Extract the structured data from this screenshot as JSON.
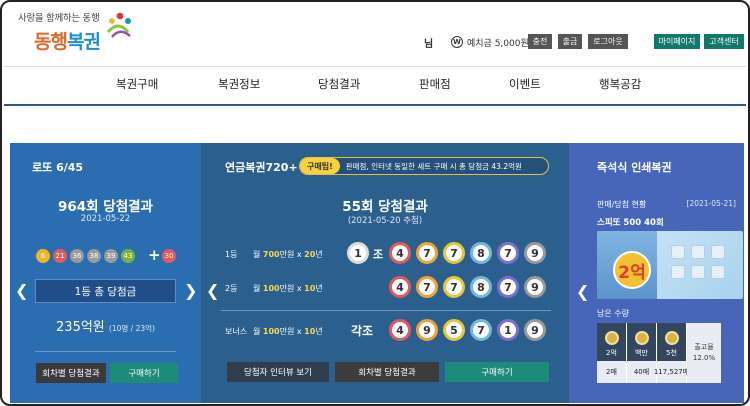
{
  "header": {
    "slogan": "사랑을 함께하는 동행",
    "brand_part1": "동행",
    "brand_part2": "복권",
    "user_suffix": "님",
    "won_symbol": "W",
    "deposit": "예치금 5,000원",
    "buttons": [
      "충전",
      "출금",
      "로그아웃",
      "마이페이지",
      "고객센터"
    ]
  },
  "nav": [
    "복권구매",
    "복권정보",
    "당첨결과",
    "판매점",
    "이벤트",
    "행복공감"
  ],
  "lotto": {
    "title": "로또 6/45",
    "round": "964회 당첨결과",
    "date": "2021-05-22",
    "numbers": [
      "6",
      "21",
      "36",
      "38",
      "39",
      "43"
    ],
    "bonus": "30",
    "plus": "+",
    "first_prize_label": "1등 총 당첨금",
    "amount": "235억원",
    "amount_detail": "(10명 / 23억)",
    "btn_results": "회차별 당첨결과",
    "btn_buy": "구매하기",
    "ball_colors": [
      "#f0b62a",
      "#e45b5b",
      "#9a9a9a",
      "#9a9a9a",
      "#9a9a9a",
      "#7bb23e",
      "#e45b5b"
    ]
  },
  "pension": {
    "title": "연금복권720+",
    "tip_label": "구매팁!",
    "tip_text": "판매점, 인터넷 동일한 세트 구매 시 총 당첨금 43.2억원",
    "round": "55회 당첨결과",
    "date": "(2021-05-20 추첨)",
    "rows": [
      {
        "rank": "1등",
        "desc_prefix": "월 ",
        "desc_amount": "700",
        "desc_mid": "만원 x ",
        "desc_years": "20",
        "desc_suffix": "년",
        "jo": "1",
        "jo_label": "조",
        "digits": [
          "4",
          "7",
          "7",
          "8",
          "7",
          "9"
        ]
      },
      {
        "rank": "2등",
        "desc_prefix": "월 ",
        "desc_amount": "100",
        "desc_mid": "만원 x ",
        "desc_years": "10",
        "desc_suffix": "년",
        "digits": [
          "4",
          "7",
          "7",
          "8",
          "7",
          "9"
        ]
      },
      {
        "rank": "보너스",
        "desc_prefix": "월 ",
        "desc_amount": "100",
        "desc_mid": "만원 x ",
        "desc_years": "10",
        "desc_suffix": "년",
        "gakjo": "각조",
        "digits": [
          "4",
          "9",
          "5",
          "7",
          "1",
          "9"
        ]
      }
    ],
    "digit_colors": [
      "#e25a5a",
      "#f0a23a",
      "#e6c53a",
      "#6fb8e0",
      "#7b6fd0",
      "#9a9a9a"
    ],
    "btn_interview": "당첨자 인터뷰 보기",
    "btn_results": "회차별 당첨결과",
    "btn_buy": "구매하기"
  },
  "instant": {
    "title": "즉석식 인쇄복권",
    "status_label": "판매/당첨 현황",
    "date": "[2021-05-21]",
    "game_name": "스피또 500 40회",
    "ticket_badge": "2억",
    "remain_label": "남은 수량",
    "cols": [
      {
        "top": "2억",
        "bottom": "2매"
      },
      {
        "top": "백만",
        "bottom": "40매"
      },
      {
        "top": "5천",
        "bottom": "117,527매"
      }
    ],
    "total_label": "출고율",
    "total_value": "12.0%"
  }
}
